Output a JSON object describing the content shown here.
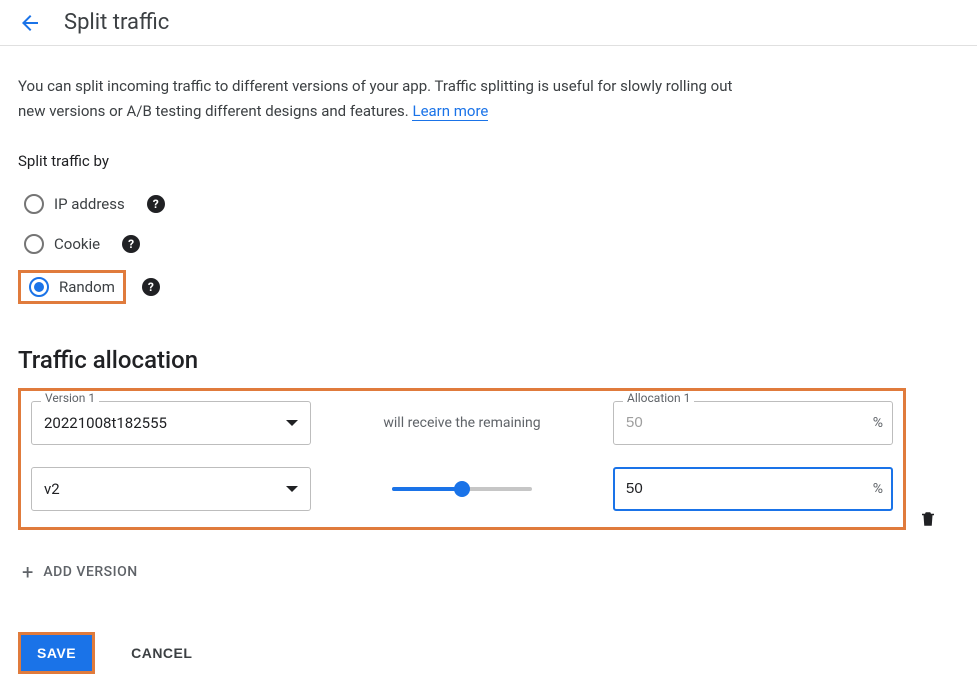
{
  "header": {
    "title": "Split traffic"
  },
  "intro": {
    "text": "You can split incoming traffic to different versions of your app. Traffic splitting is useful for slowly rolling out new versions or A/B testing different designs and features. ",
    "learn_more": "Learn more"
  },
  "split_by": {
    "label": "Split traffic by",
    "options": {
      "ip": "IP address",
      "cookie": "Cookie",
      "random": "Random"
    },
    "selected": "random"
  },
  "allocation": {
    "heading": "Traffic allocation",
    "rows": [
      {
        "version_label": "Version 1",
        "version_value": "20221008t182555",
        "note": "will receive the remaining",
        "alloc_label": "Allocation 1",
        "alloc_value": "50",
        "disabled": true
      },
      {
        "version_value": "v2",
        "alloc_value": "50",
        "focused": true,
        "has_slider": true,
        "slider_percent": 50,
        "deletable": true
      }
    ],
    "percent_suffix": "%",
    "add_version": "ADD VERSION"
  },
  "actions": {
    "save": "SAVE",
    "cancel": "CANCEL"
  },
  "icons": {
    "back": "arrow-left-icon",
    "help": "?",
    "dropdown": "chevron-down-icon",
    "trash": "trash-icon",
    "plus": "+"
  }
}
